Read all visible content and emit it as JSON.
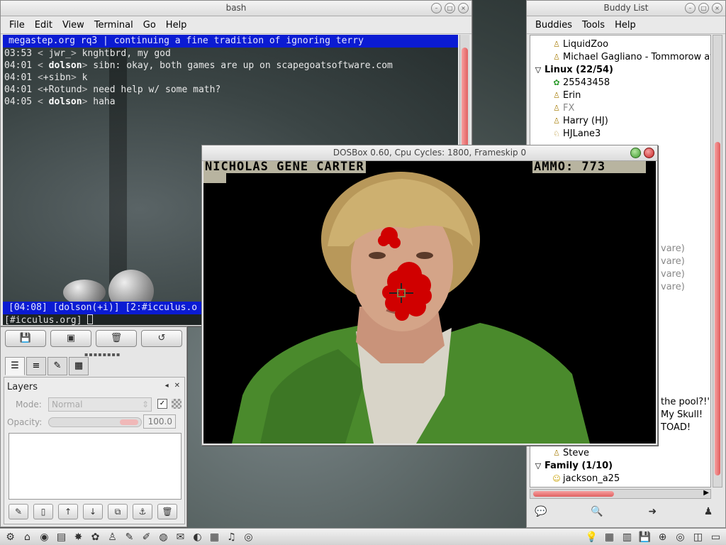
{
  "terminal": {
    "title": "bash",
    "menu": [
      "File",
      "Edit",
      "View",
      "Terminal",
      "Go",
      "Help"
    ],
    "topic": "megastep.org rq3 | continuing a fine tradition of ignoring terry",
    "lines": [
      {
        "time": "03:53",
        "open": "<",
        "nick": " jwr_",
        "close": ">",
        "msg": " knghtbrd, my god",
        "bold": false
      },
      {
        "time": "04:01",
        "open": "<",
        "nick": " dolson",
        "close": ">",
        "msg": " sibn: okay, both games are up on scapegoatsoftware.com",
        "bold": true
      },
      {
        "time": "04:01",
        "open": "<",
        "nick": "+sibn",
        "close": ">",
        "msg": " k",
        "bold": false
      },
      {
        "time": "04:01",
        "open": "<",
        "nick": "+Rotund",
        "close": ">",
        "msg": " need help w/ some math?",
        "bold": false
      },
      {
        "time": "04:05",
        "open": "<",
        "nick": " dolson",
        "close": ">",
        "msg": " haha",
        "bold": true
      }
    ],
    "status": "[04:08] [dolson(+i)] [2:#icculus.o",
    "prompt": "[#icculus.org] "
  },
  "gimp": {
    "panel_title": "Layers",
    "mode_label": "Mode:",
    "mode_value": "Normal",
    "opacity_label": "Opacity:",
    "opacity_value": "100.0"
  },
  "buddy": {
    "title": "Buddy List",
    "menu": [
      "Buddies",
      "Tools",
      "Help"
    ],
    "rows": [
      {
        "type": "buddy",
        "name": "LiquidZoo",
        "icon": "aim-person-icon",
        "idle": false
      },
      {
        "type": "buddy",
        "name": "Michael Gagliano - Tommorow at",
        "icon": "aim-person-icon",
        "idle": false
      },
      {
        "type": "group",
        "name": "Linux (22/54)"
      },
      {
        "type": "buddy",
        "name": "25543458",
        "icon": "icq-flower-icon",
        "idle": false
      },
      {
        "type": "buddy",
        "name": "Erin",
        "icon": "aim-person-icon",
        "idle": false
      },
      {
        "type": "buddy",
        "name": "FX",
        "icon": "aim-person-icon",
        "idle": true
      },
      {
        "type": "buddy",
        "name": "Harry (HJ)",
        "icon": "aim-person-icon",
        "idle": false
      },
      {
        "type": "buddy",
        "name": "HJLane3",
        "icon": "aim-running-icon",
        "idle": false
      }
    ],
    "fragments": [
      "vare)",
      "vare)",
      "vare)",
      "vare)",
      "the pool?!'",
      "My Skull!",
      "TOAD!"
    ],
    "bottom_rows": [
      {
        "type": "buddy",
        "name": "Steve",
        "icon": "aim-person-icon",
        "idle": false
      },
      {
        "type": "group",
        "name": "Family (1/10)"
      },
      {
        "type": "buddy",
        "name": "jackson_a25",
        "icon": "smiley-icon",
        "idle": false
      }
    ]
  },
  "dosbox": {
    "title": "DOSBox 0.60, Cpu Cycles:      1800, Frameskip  0",
    "hud_name": "NICHOLAS GENE CARTER",
    "hud_ammo": "AMMO: 773"
  }
}
